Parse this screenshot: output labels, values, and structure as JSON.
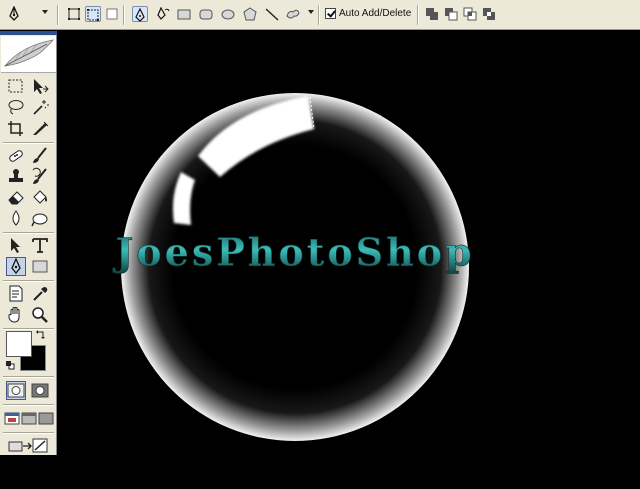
{
  "options_bar": {
    "auto_add_delete_label": "Auto Add/Delete",
    "auto_add_delete_checked": true,
    "active_tool_icon": "pen-icon",
    "shape_icons": [
      "paths-mode-icon",
      "shape-layers-mode-icon",
      "fill-pixels-mode-icon",
      "pen-icon",
      "freeform-pen-icon",
      "rectangle-icon",
      "rounded-rectangle-icon",
      "ellipse-icon",
      "polygon-icon",
      "line-icon",
      "custom-shape-icon"
    ],
    "path_operation_icons": [
      "add-to-path-icon",
      "subtract-from-path-icon",
      "intersect-path-icon",
      "exclude-path-icon"
    ]
  },
  "tools_panel": {
    "active_tool": "pen-tool",
    "foreground_color": "#ffffff",
    "background_color": "#000000"
  },
  "canvas": {
    "background": "#000000",
    "text_art": "JoesPhotoShop",
    "text_color": "#2aa3a0"
  }
}
